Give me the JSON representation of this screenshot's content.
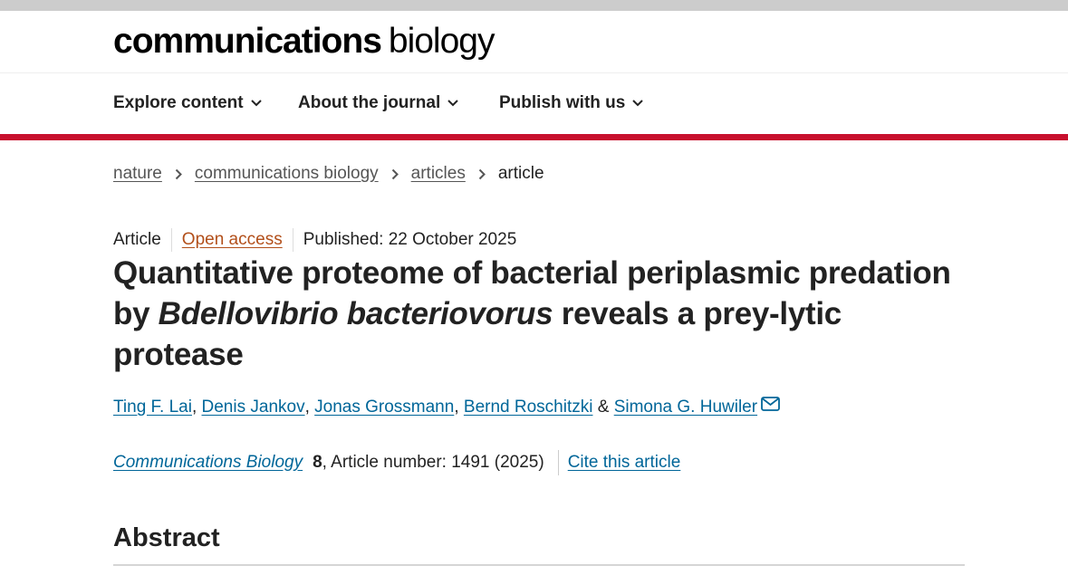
{
  "logo": {
    "bold": "communications",
    "light": "biology"
  },
  "nav": {
    "items": [
      {
        "label": "Explore content"
      },
      {
        "label": "About the journal"
      },
      {
        "label": "Publish with us"
      }
    ]
  },
  "breadcrumb": {
    "items": [
      "nature",
      "communications biology",
      "articles"
    ],
    "current": "article"
  },
  "article": {
    "type": "Article",
    "access": "Open access",
    "published": "Published: 22 October 2025",
    "title_part1": "Quantitative proteome of bacterial periplasmic predation by ",
    "title_italic": "Bdellovibrio bacteriovorus",
    "title_part2": " reveals a prey-lytic protease",
    "authors": [
      "Ting F. Lai",
      "Denis Jankov",
      "Jonas Grossmann",
      "Bernd Roschitzki",
      "Simona G. Huwiler"
    ],
    "author_separator": ", ",
    "author_last_separator": " & ",
    "citation": {
      "journal": "Communications Biology",
      "volume": "8",
      "rest": ", Article number: 1491 (2025)",
      "cite_label": "Cite this article"
    }
  },
  "abstract": {
    "heading": "Abstract"
  },
  "colors": {
    "accent_red": "#c8102e",
    "link_blue": "#006699",
    "open_access_orange": "#b24f1a"
  },
  "icons": {
    "nav_chevron": "chevron-down-icon",
    "breadcrumb_sep": "chevron-right-icon",
    "corresponding": "envelope-icon"
  }
}
